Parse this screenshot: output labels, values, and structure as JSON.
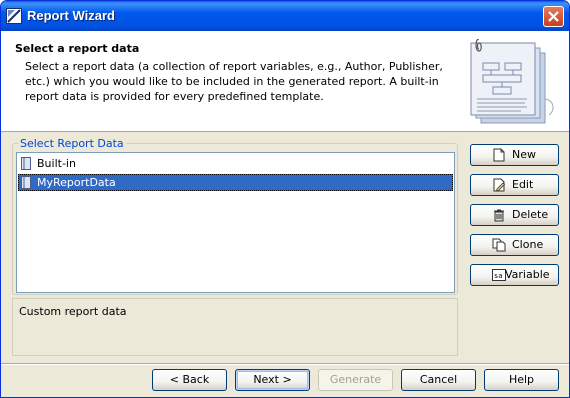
{
  "window": {
    "title": "Report Wizard"
  },
  "header": {
    "title": "Select a report data",
    "description": "Select a report data (a collection of report variables, e.g., Author, Publisher, etc.) which you would like to be included in the generated report. A built-in report data is provided for every predefined template."
  },
  "group": {
    "legend": "Select Report Data",
    "items": [
      {
        "label": "Built-in",
        "selected": false
      },
      {
        "label": "MyReportData",
        "selected": true
      }
    ]
  },
  "description_box": {
    "text": "Custom report data"
  },
  "side_buttons": {
    "new": "New",
    "edit": "Edit",
    "delete": "Delete",
    "clone": "Clone",
    "variable": "Variable"
  },
  "footer": {
    "back": "< Back",
    "next": "Next >",
    "generate": "Generate",
    "cancel": "Cancel",
    "help": "Help"
  },
  "colors": {
    "title_bar": "#0058ee",
    "selection": "#316ac5",
    "legend": "#0046d5"
  }
}
